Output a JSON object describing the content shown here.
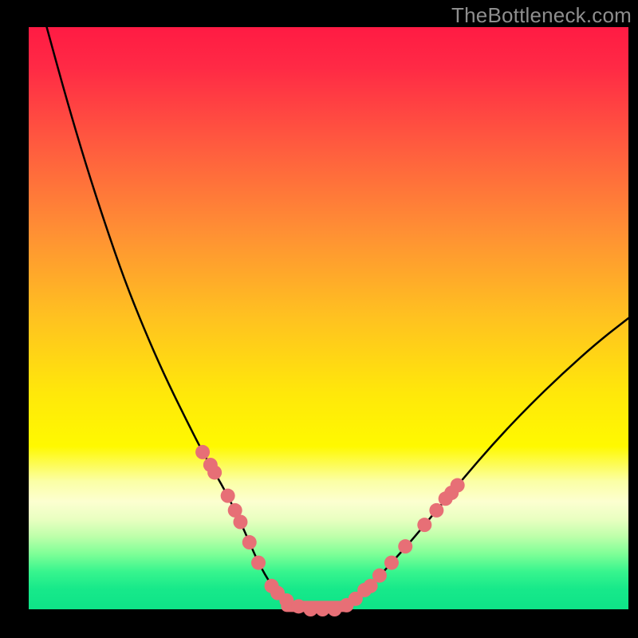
{
  "watermark": "TheBottleneck.com",
  "chart_data": {
    "type": "line",
    "title": "",
    "xlabel": "",
    "ylabel": "",
    "xlim": [
      0,
      100
    ],
    "ylim": [
      0,
      100
    ],
    "background_gradient": {
      "stops": [
        {
          "offset": 0.0,
          "color": "#ff1b44"
        },
        {
          "offset": 0.07,
          "color": "#ff2a45"
        },
        {
          "offset": 0.2,
          "color": "#ff5a3f"
        },
        {
          "offset": 0.35,
          "color": "#ff8f34"
        },
        {
          "offset": 0.5,
          "color": "#ffc220"
        },
        {
          "offset": 0.63,
          "color": "#ffe80a"
        },
        {
          "offset": 0.72,
          "color": "#fff900"
        },
        {
          "offset": 0.78,
          "color": "#fbffa5"
        },
        {
          "offset": 0.815,
          "color": "#fcffd0"
        },
        {
          "offset": 0.845,
          "color": "#e9ffc1"
        },
        {
          "offset": 0.875,
          "color": "#bdffaa"
        },
        {
          "offset": 0.905,
          "color": "#7eff97"
        },
        {
          "offset": 0.935,
          "color": "#38f58e"
        },
        {
          "offset": 0.965,
          "color": "#17e98a"
        },
        {
          "offset": 1.0,
          "color": "#0ee388"
        }
      ]
    },
    "series": [
      {
        "name": "bottleneck-curve",
        "color": "#000000",
        "x": [
          3.0,
          6.2,
          9.5,
          12.8,
          16.0,
          19.3,
          22.5,
          25.8,
          29.0,
          31.0,
          33.2,
          35.3,
          36.8,
          38.3,
          40.5,
          43.0,
          47.0,
          51.0,
          54.0,
          57.0,
          60.5,
          64.0,
          68.0,
          72.5,
          77.5,
          83.0,
          89.0,
          95.0,
          100.0
        ],
        "y": [
          100.0,
          88.0,
          76.5,
          66.0,
          56.5,
          48.0,
          40.5,
          33.5,
          27.0,
          23.5,
          19.5,
          15.0,
          11.5,
          8.0,
          4.0,
          1.5,
          0.0,
          0.0,
          1.5,
          4.0,
          8.0,
          12.0,
          17.0,
          22.5,
          28.5,
          34.5,
          40.5,
          46.0,
          50.0
        ]
      }
    ],
    "markers": {
      "color": "#e76f76",
      "radius": 2.0,
      "points": [
        {
          "x": 29.0,
          "y": 27.0
        },
        {
          "x": 30.3,
          "y": 24.8
        },
        {
          "x": 31.0,
          "y": 23.5
        },
        {
          "x": 33.2,
          "y": 19.5
        },
        {
          "x": 34.4,
          "y": 17.0
        },
        {
          "x": 35.3,
          "y": 15.0
        },
        {
          "x": 36.8,
          "y": 11.5
        },
        {
          "x": 38.3,
          "y": 8.0
        },
        {
          "x": 40.5,
          "y": 4.0
        },
        {
          "x": 41.5,
          "y": 2.8
        },
        {
          "x": 43.0,
          "y": 1.5
        },
        {
          "x": 45.0,
          "y": 0.5
        },
        {
          "x": 47.0,
          "y": 0.0
        },
        {
          "x": 49.0,
          "y": 0.0
        },
        {
          "x": 51.0,
          "y": 0.0
        },
        {
          "x": 53.0,
          "y": 0.7
        },
        {
          "x": 54.5,
          "y": 1.8
        },
        {
          "x": 56.0,
          "y": 3.3
        },
        {
          "x": 57.0,
          "y": 4.0
        },
        {
          "x": 58.5,
          "y": 5.8
        },
        {
          "x": 60.5,
          "y": 8.0
        },
        {
          "x": 62.8,
          "y": 10.8
        },
        {
          "x": 66.0,
          "y": 14.5
        },
        {
          "x": 68.0,
          "y": 17.0
        },
        {
          "x": 69.5,
          "y": 19.0
        },
        {
          "x": 70.5,
          "y": 20.0
        },
        {
          "x": 71.5,
          "y": 21.3
        }
      ]
    },
    "flat_segment": {
      "x0": 43.0,
      "x1": 53.0,
      "y": 0.5,
      "color": "#e76f76",
      "width": 2.2
    }
  }
}
